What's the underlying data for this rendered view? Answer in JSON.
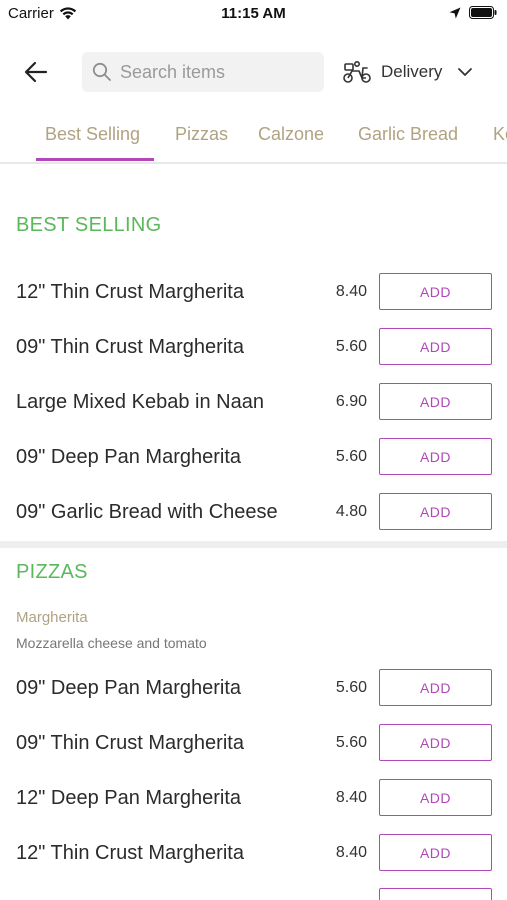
{
  "status_bar": {
    "carrier": "Carrier",
    "time": "11:15 AM"
  },
  "header": {
    "search_placeholder": "Search items",
    "delivery_label": "Delivery",
    "icons": [
      "back-arrow-icon",
      "search-icon",
      "scooter-icon",
      "chevron-down-icon"
    ]
  },
  "tabs": [
    "Best Selling",
    "Pizzas",
    "Calzone",
    "Garlic Bread",
    "Ke"
  ],
  "active_tab": "Best Selling",
  "colors": {
    "accent": "#b048b8",
    "section_title": "#5ab85a",
    "tab_text": "#b0a382"
  },
  "best_selling": {
    "title": "BEST SELLING",
    "items": [
      {
        "name": "12\" Thin Crust Margherita",
        "price": "8.40",
        "button": "ADD"
      },
      {
        "name": "09\" Thin Crust Margherita",
        "price": "5.60",
        "button": "ADD"
      },
      {
        "name": "Large Mixed Kebab in Naan",
        "price": "6.90",
        "button": "ADD"
      },
      {
        "name": "09\" Deep Pan Margherita",
        "price": "5.60",
        "button": "ADD"
      },
      {
        "name": "09\" Garlic Bread with Cheese",
        "price": "4.80",
        "button": "ADD"
      }
    ]
  },
  "pizzas": {
    "title": "PIZZAS",
    "group_name": "Margherita",
    "group_desc": "Mozzarella cheese and tomato",
    "items": [
      {
        "name": "09\" Deep Pan Margherita",
        "price": "5.60",
        "button": "ADD"
      },
      {
        "name": "09\" Thin Crust Margherita",
        "price": "5.60",
        "button": "ADD"
      },
      {
        "name": "12\" Deep Pan Margherita",
        "price": "8.40",
        "button": "ADD"
      },
      {
        "name": "12\" Thin Crust Margherita",
        "price": "8.40",
        "button": "ADD"
      }
    ]
  }
}
